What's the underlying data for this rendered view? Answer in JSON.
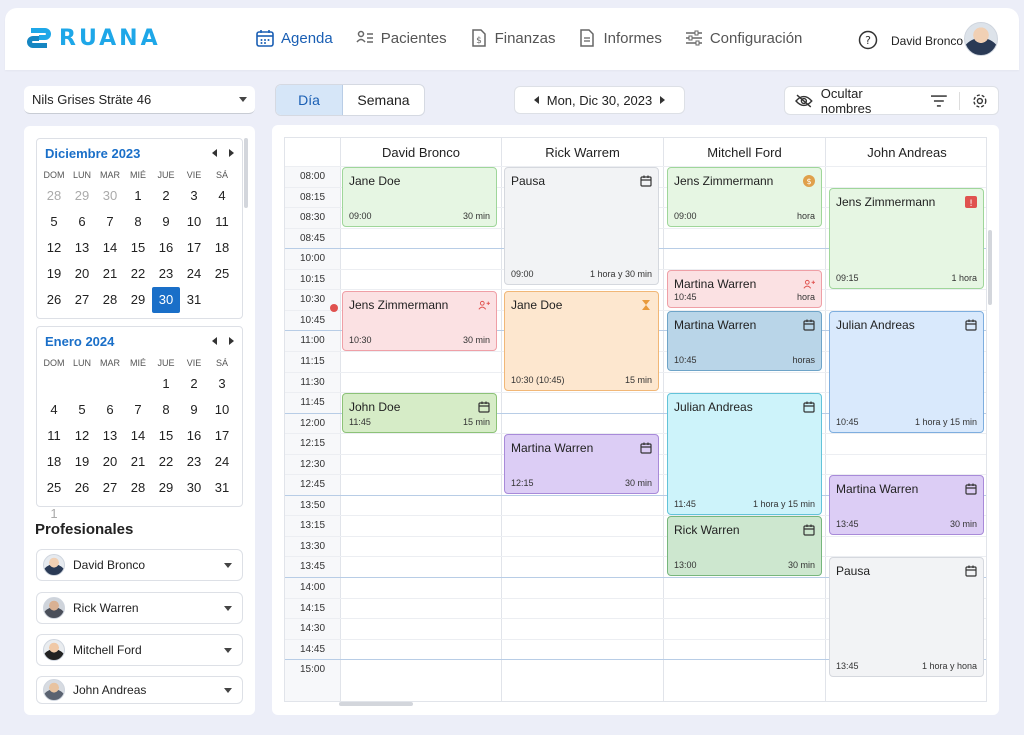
{
  "app": {
    "brand": "RUANA",
    "brand_color": "#1ea7e8"
  },
  "nav": [
    {
      "label": "Agenda",
      "icon": "calendar-icon",
      "active": true
    },
    {
      "label": "Pacientes",
      "icon": "patients-icon"
    },
    {
      "label": "Finanzas",
      "icon": "finance-icon"
    },
    {
      "label": "Informes",
      "icon": "report-icon"
    },
    {
      "label": "Configuración",
      "icon": "settings-sliders-icon"
    }
  ],
  "user": {
    "name": "David Bronco"
  },
  "location": {
    "value": "Nils Grises Sträte 46"
  },
  "mini_cal_1": {
    "title": "Diciembre 2023",
    "dow": [
      "DOM",
      "LUN",
      "MAR",
      "MIÉ",
      "JUE",
      "VIE",
      "SÁ"
    ],
    "days": [
      "28",
      "29",
      "30",
      "1",
      "2",
      "3",
      "4",
      "5",
      "6",
      "7",
      "8",
      "9",
      "10",
      "11",
      "12",
      "13",
      "14",
      "15",
      "16",
      "17",
      "18",
      "19",
      "20",
      "21",
      "22",
      "23",
      "24",
      "25",
      "26",
      "27",
      "28",
      "29",
      "30",
      "31"
    ]
  },
  "mini_cal_2": {
    "title": "Enero 2024",
    "dow": [
      "DOM",
      "LUN",
      "MAR",
      "MIÉ",
      "JUE",
      "VIE",
      "SÁ"
    ],
    "days": [
      "1",
      "2",
      "3",
      "4",
      "5",
      "6",
      "7",
      "8",
      "9",
      "10",
      "11",
      "12",
      "13",
      "14",
      "15",
      "16",
      "17",
      "18",
      "19",
      "20",
      "21",
      "22",
      "23",
      "24",
      "25",
      "26",
      "27",
      "28",
      "29",
      "30",
      "31",
      "1"
    ]
  },
  "profesionales": {
    "title": "Profesionales",
    "items": [
      "David Bronco",
      "Rick Warren",
      "Mitchell Ford",
      "John Andreas"
    ]
  },
  "view": {
    "day": "Día",
    "week": "Semana"
  },
  "date_nav": {
    "label": "Mon, Dic 30, 2023"
  },
  "tools": {
    "hide_names": "Ocultar nombres"
  },
  "columns": [
    "David Bronco",
    "Rick Warrem",
    "Mitchell Ford",
    "John Andreas"
  ],
  "times": [
    "08:00",
    "08:15",
    "08:30",
    "08:45",
    "10:00",
    "10:15",
    "10:30",
    "10:45",
    "11:00",
    "11:15",
    "11:30",
    "11:45",
    "12:00",
    "12:15",
    "12:30",
    "12:45",
    "13:50",
    "13:15",
    "13:30",
    "13:45",
    "14:00",
    "14:15",
    "14:30",
    "14:45",
    "15:00"
  ],
  "appointments": [
    {
      "name": "Jane Doe",
      "time": "09:00",
      "dur": "30 min"
    },
    {
      "name": "Pausa",
      "time": "09:00",
      "dur": "1 hora y 30 min"
    },
    {
      "name": "Jens Zimmermann",
      "time": "09:00",
      "dur": "hora"
    },
    {
      "name": "Jens Zimmermann",
      "time": "09:15",
      "dur": "1 hora"
    },
    {
      "name": "Martina Warren",
      "time": "10:45",
      "dur": "hora"
    },
    {
      "name": "Jens Zimmermann",
      "time": "10:30",
      "dur": "30 min"
    },
    {
      "name": "Jane Doe",
      "time": "10:30 (10:45)",
      "dur": "15 min"
    },
    {
      "name": "Martina Warren",
      "time": "10:45",
      "dur": "horas"
    },
    {
      "name": "Julian Andreas",
      "time": "10:45",
      "dur": "1 hora y 15 min"
    },
    {
      "name": "John Doe",
      "time": "11:45",
      "dur": "15 min"
    },
    {
      "name": "Julian Andreas",
      "time": "11:45",
      "dur": "1 hora y 15 min"
    },
    {
      "name": "Martina Warren",
      "time": "12:15",
      "dur": "30 min"
    },
    {
      "name": "Martina Warren",
      "time": "13:45",
      "dur": "30 min"
    },
    {
      "name": "Rick Warren",
      "time": "13:00",
      "dur": "30 min"
    },
    {
      "name": "Pausa",
      "time": "13:45",
      "dur": "1 hora y hona"
    }
  ]
}
